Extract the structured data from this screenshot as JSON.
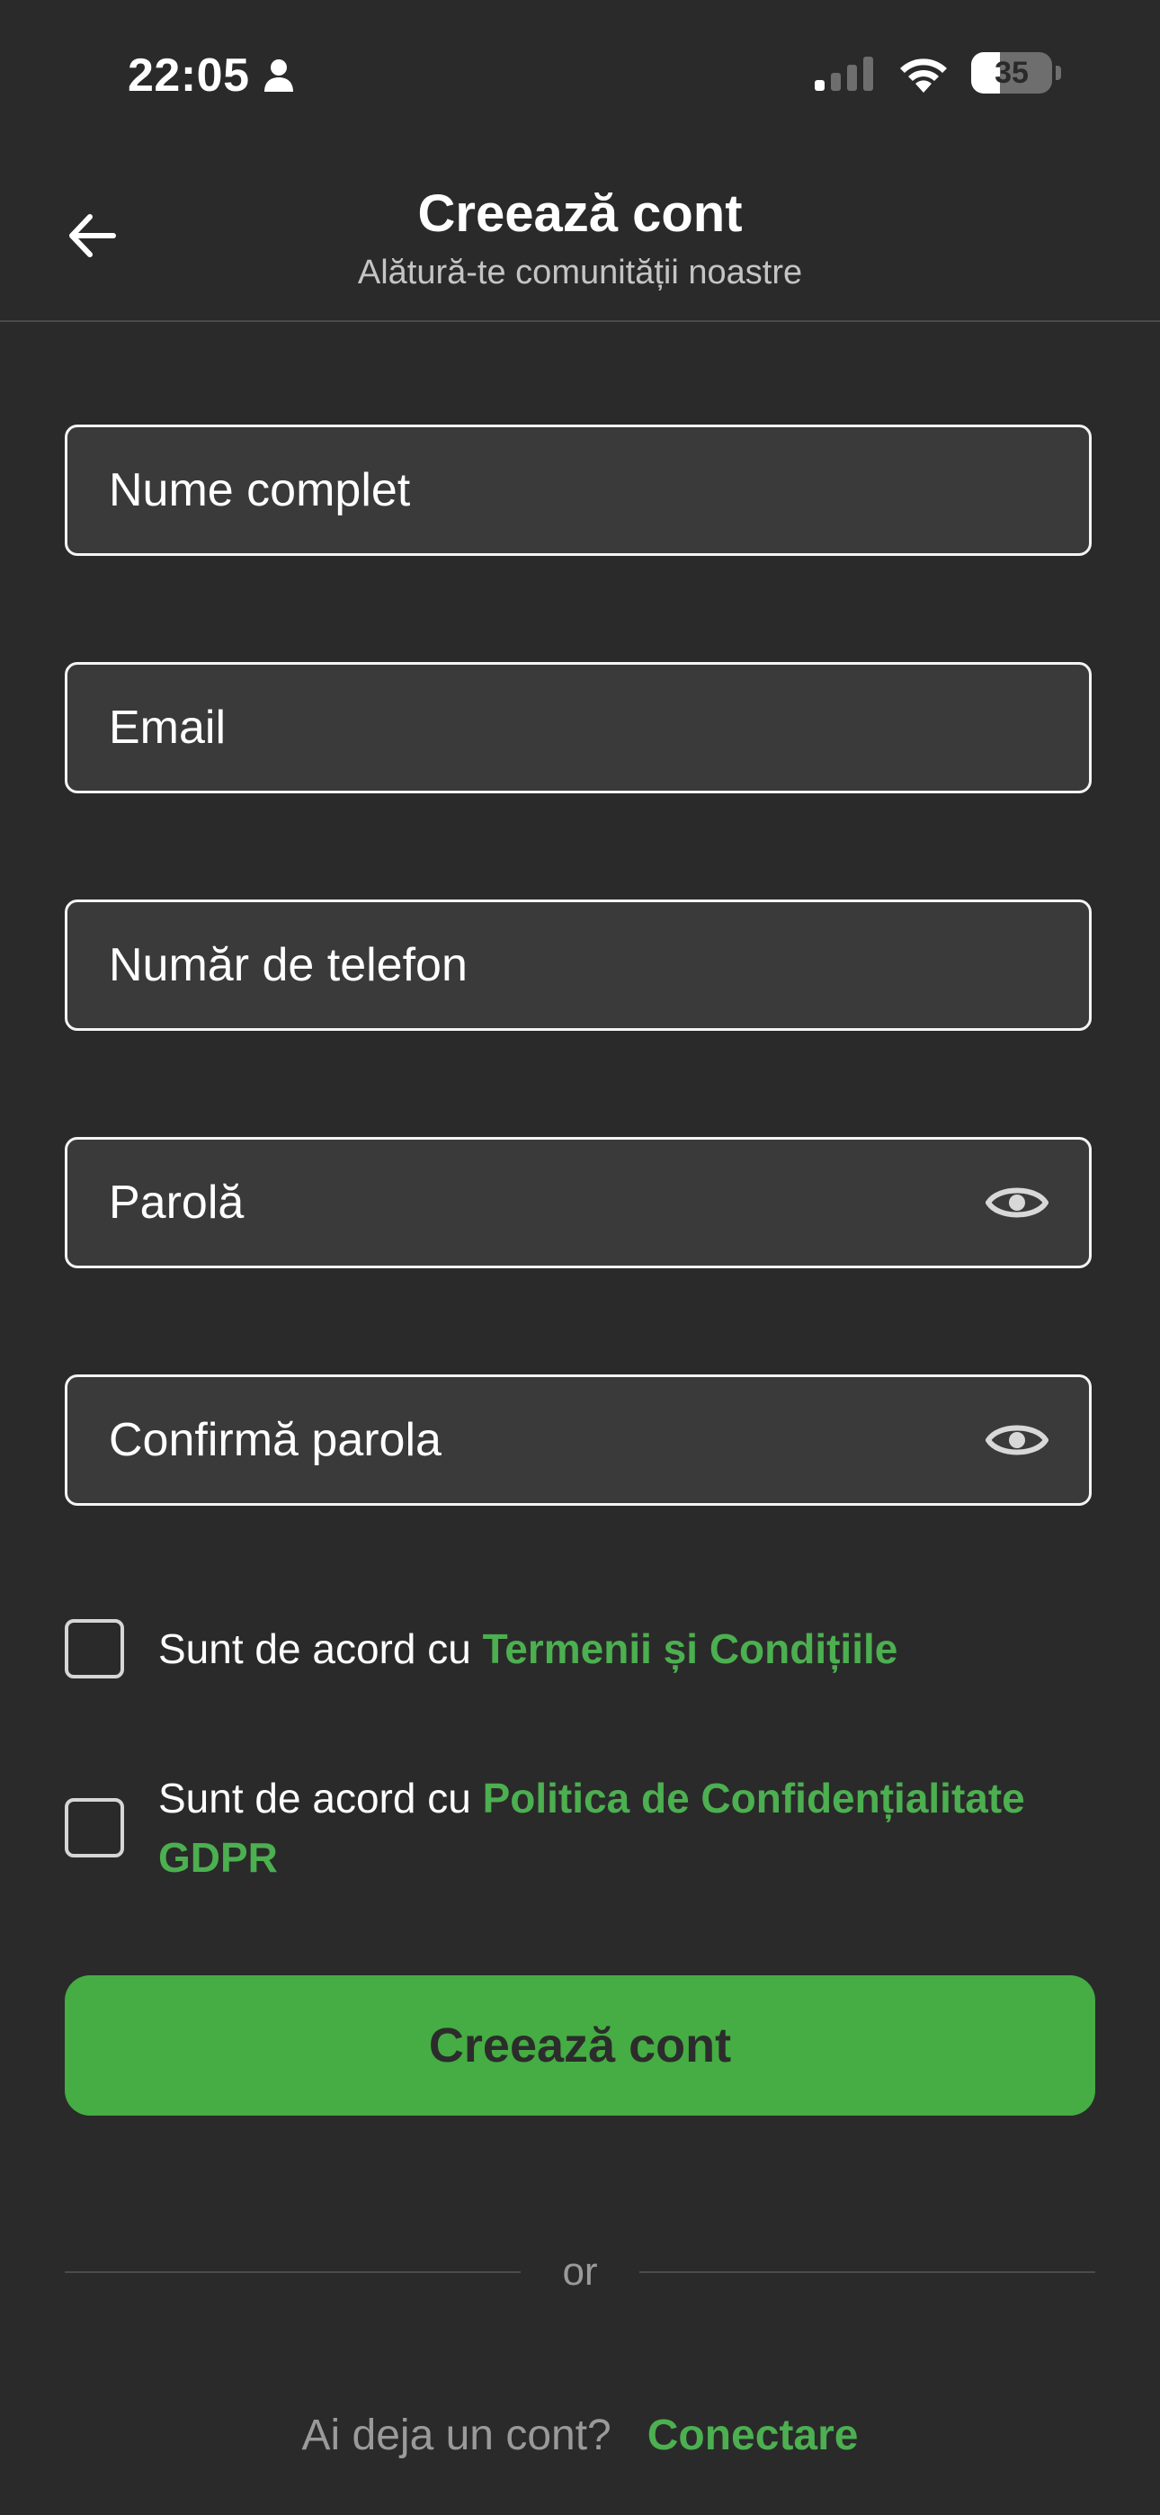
{
  "status_bar": {
    "time": "22:05",
    "battery_level": "35",
    "battery_fraction": 0.35,
    "icons": [
      "person-icon",
      "cellular-signal-icon",
      "wifi-icon",
      "battery-icon"
    ]
  },
  "header": {
    "title": "Creează cont",
    "subtitle": "Alătură-te comunității noastre",
    "back_icon": "arrow-left-icon"
  },
  "form": {
    "full_name": {
      "placeholder": "Nume complet",
      "value": ""
    },
    "email": {
      "placeholder": "Email",
      "value": ""
    },
    "phone": {
      "placeholder": "Număr de telefon",
      "value": ""
    },
    "password": {
      "placeholder": "Parolă",
      "value": "",
      "icon": "eye-icon"
    },
    "confirm_password": {
      "placeholder": "Confirmă parola",
      "value": "",
      "icon": "eye-icon"
    }
  },
  "agreements": {
    "terms": {
      "prefix": "Sunt de acord cu ",
      "link": "Termenii și Condițiile",
      "checked": false
    },
    "privacy": {
      "prefix": "Sunt de acord cu ",
      "link": "Politica de Confidențialitate GDPR",
      "checked": false
    }
  },
  "submit_label": "Creează cont",
  "divider_text": "or",
  "footer": {
    "prompt": "Ai deja un cont?",
    "link": "Conectare"
  },
  "colors": {
    "background": "#2a2a2a",
    "field_background": "#3a3a3a",
    "accent_green": "#45ad43",
    "link_green": "#4caf50"
  }
}
